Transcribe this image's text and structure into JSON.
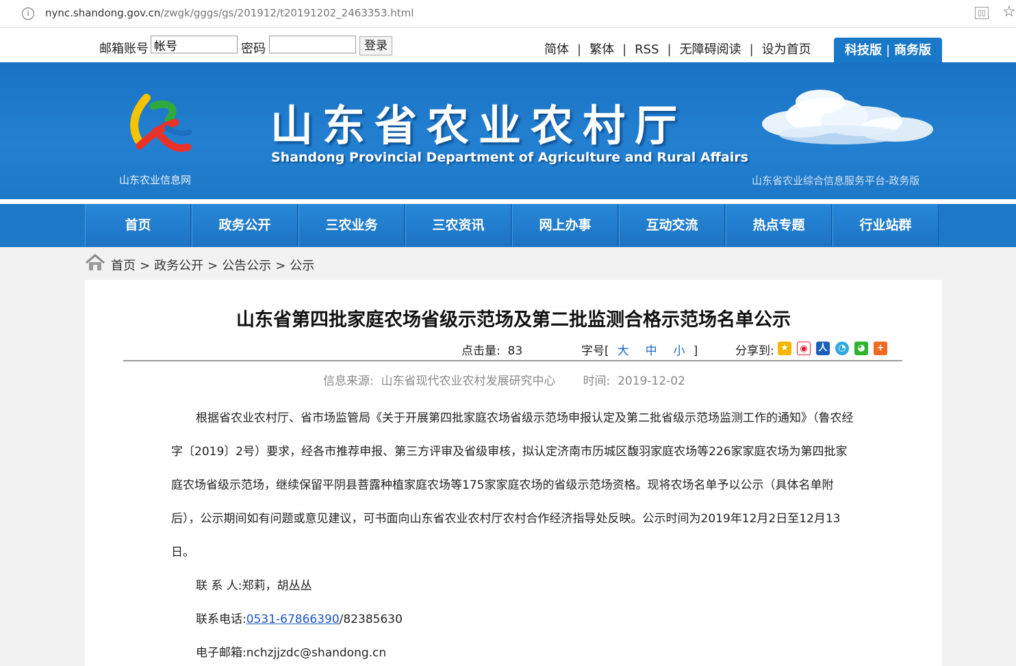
{
  "browser": {
    "url_host": "nync.shandong.gov.cn",
    "url_path": "/zwgk/gggs/gs/201912/t20191202_2463353.html",
    "info_icon": "info-icon",
    "reader_icon": "reader-mode-icon",
    "star_icon": "bookmark-star-icon",
    "info_glyph": "i",
    "star_glyph": "☆"
  },
  "topbar": {
    "mail_label": "邮箱账号",
    "account_value": "帐号",
    "password_label": "密码",
    "password_value": "",
    "login_label": "登录",
    "links": [
      "简体",
      "繁体",
      "RSS",
      "无障碍阅读",
      "设为首页"
    ],
    "separator": "|",
    "version_tech": "科技版",
    "version_business": "商务版",
    "version_sep": "|"
  },
  "banner": {
    "logo_caption": "山东农业信息网",
    "title_cn": "山东省农业农村厅",
    "title_en": "Shandong Provincial Department of Agriculture and Rural Affairs",
    "platform": "山东省农业综合信息服务平台-政务版"
  },
  "nav": {
    "items": [
      "首页",
      "政务公开",
      "三农业务",
      "三农资讯",
      "网上办事",
      "互动交流",
      "热点专题",
      "行业站群"
    ]
  },
  "breadcrumb": {
    "items": [
      "首页",
      "政务公开",
      "公告公示",
      "公示"
    ],
    "separator": ">"
  },
  "article": {
    "title": "山东省第四批家庭农场省级示范场及第二批监测合格示范场名单公示",
    "hits_label": "点击量:",
    "hits_value": "83",
    "fontsize_label": "字号[",
    "fontsize_large": "大",
    "fontsize_medium": "中",
    "fontsize_small": "小",
    "fontsize_close": "]",
    "share_label": "分享到:",
    "share_icons": [
      "qzone-icon",
      "weibo-icon",
      "renren-icon",
      "tencent-weibo-icon",
      "wechat-icon",
      "more-share-icon"
    ],
    "source_label": "信息来源:",
    "source_value": "山东省现代农业农村发展研究中心",
    "time_label": "时间:",
    "time_value": "2019-12-02",
    "paragraph": "根据省农业农村厅、省市场监管局《关于开展第四批家庭农场省级示范场申报认定及第二批省级示范场监测工作的通知》（鲁农经字〔2019〕2号）要求，经各市推荐申报、第三方评审及省级审核，拟认定济南市历城区馥羽家庭农场等226家家庭农场为第四批家庭农场省级示范场，继续保留平阴县菩露种植家庭农场等175家家庭农场的省级示范场资格。现将农场名单予以公示（具体名单附后），公示期间如有问题或意见建议，可书面向山东省农业农村厅农村合作经济指导处反映。公示时间为2019年12月2日至12月13日。",
    "contact_label": "联 系 人:",
    "contact_value": "郑莉，胡丛丛",
    "phone_label": "联系电话:",
    "phone_link": "0531-67866390",
    "phone_rest": "/82385630",
    "email_label": "电子邮箱:",
    "email_value": "nchzjjzdc@shandong.cn"
  }
}
